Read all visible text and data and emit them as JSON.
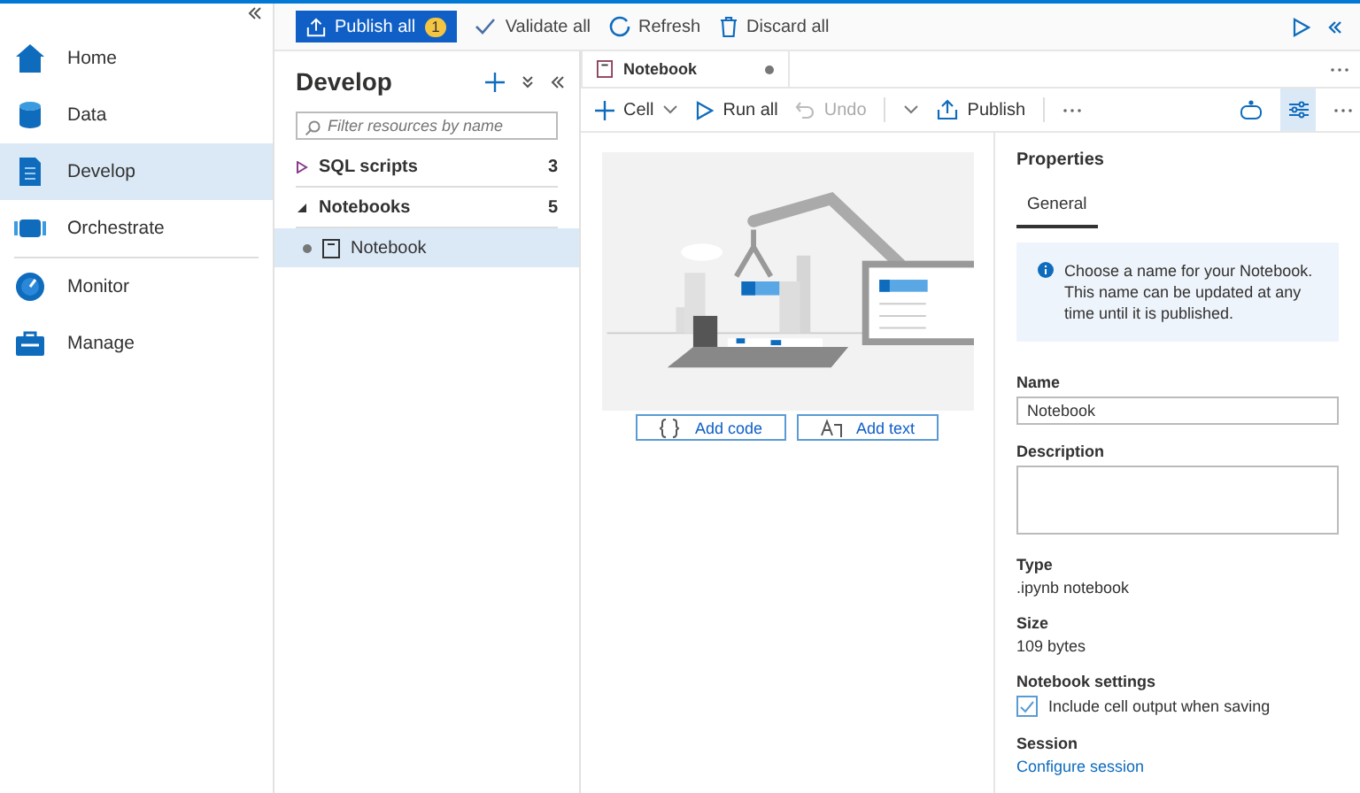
{
  "nav": {
    "items": [
      {
        "label": "Home",
        "kind": "home",
        "selected": false
      },
      {
        "label": "Data",
        "kind": "data",
        "selected": false
      },
      {
        "label": "Develop",
        "kind": "develop",
        "selected": true
      },
      {
        "label": "Orchestrate",
        "kind": "orchestrate",
        "selected": false
      },
      {
        "label": "Monitor",
        "kind": "monitor",
        "selected": false
      },
      {
        "label": "Manage",
        "kind": "manage",
        "selected": false
      }
    ]
  },
  "toolbar": {
    "publish_all": {
      "label": "Publish all",
      "badge": "1"
    },
    "actions": [
      {
        "label": "Validate all",
        "kind": "check"
      },
      {
        "label": "Refresh",
        "kind": "refresh"
      },
      {
        "label": "Discard all",
        "kind": "trash"
      }
    ]
  },
  "develop": {
    "title": "Develop",
    "filter": {
      "placeholder": "Filter resources by name"
    },
    "groups": [
      {
        "label": "SQL scripts",
        "count": "3",
        "expanded": false
      },
      {
        "label": "Notebooks",
        "count": "5",
        "expanded": true,
        "children": [
          {
            "label": "Notebook",
            "selected": true
          }
        ]
      }
    ]
  },
  "editor_tab": {
    "label": "Notebook"
  },
  "notebook_toolbar": {
    "items": [
      {
        "label": "Cell",
        "kind": "add",
        "disabled": false
      },
      {
        "label": "Run all",
        "kind": "run",
        "disabled": false
      },
      {
        "label": "Undo",
        "kind": "undo",
        "disabled": true
      },
      {
        "label": "Publish",
        "kind": "publish",
        "disabled": false
      }
    ]
  },
  "cell_buttons": [
    {
      "label": "Add code",
      "kind": "code"
    },
    {
      "label": "Add text",
      "kind": "text"
    }
  ],
  "properties": {
    "title": "Properties",
    "tabs": [
      {
        "label": "General",
        "selected": true
      }
    ],
    "info": "Choose a name for your Notebook. This name can be updated at any time until it is published.",
    "name": {
      "label": "Name",
      "value": "Notebook"
    },
    "description": {
      "label": "Description"
    },
    "type": {
      "label": "Type",
      "value": ".ipynb notebook"
    },
    "size": {
      "label": "Size",
      "value": "109 bytes"
    },
    "settings": {
      "label": "Notebook settings",
      "option": {
        "label": "Include cell output when saving",
        "checked": true
      }
    },
    "session": {
      "label": "Session",
      "link": "Configure session"
    }
  }
}
